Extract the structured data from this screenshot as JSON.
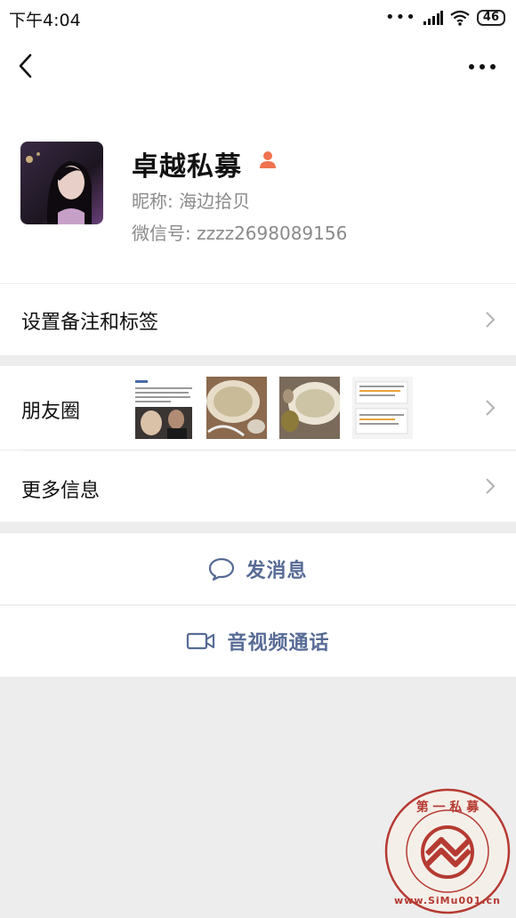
{
  "status_bar": {
    "time": "下午4:04",
    "battery": "46"
  },
  "profile": {
    "name": "卓越私募",
    "nickname": "昵称: 海边拾贝",
    "wechat_id": "微信号: zzzz2698089156"
  },
  "cells": {
    "remark_label": "设置备注和标签",
    "moments_label": "朋友圈",
    "more_info_label": "更多信息"
  },
  "actions": {
    "message_label": "发消息",
    "video_call_label": "音视频通话"
  },
  "watermark": {
    "text_top": "第 一 私 募",
    "text_bottom": "www.SiMu001.cn"
  },
  "colors": {
    "link_blue": "#576b95",
    "background": "#ededed",
    "badge_orange": "#f0734f",
    "watermark_red": "#b53a32"
  },
  "icons": [
    "back-arrow-icon",
    "more-dots-icon",
    "person-badge-icon",
    "chevron-right-icon",
    "chat-bubble-icon",
    "video-camera-icon"
  ]
}
